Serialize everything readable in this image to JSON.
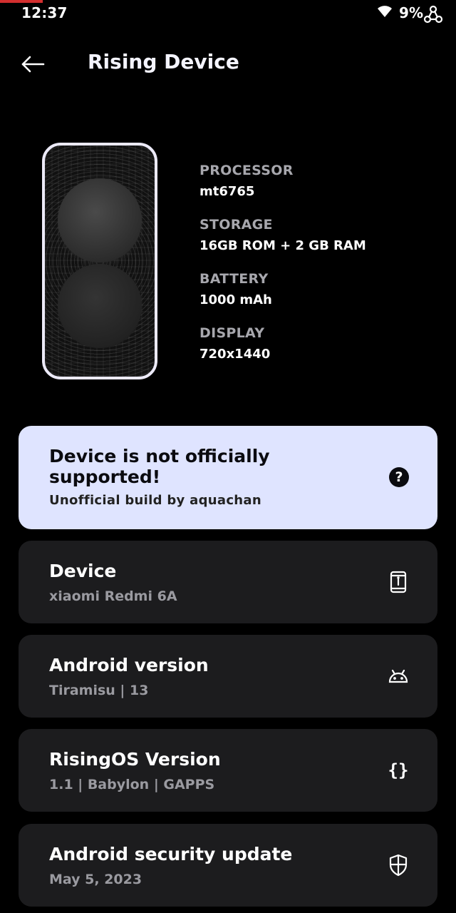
{
  "status_bar": {
    "time": "12:37",
    "battery": "9%"
  },
  "header": {
    "title": "Rising Device"
  },
  "specs": [
    {
      "label": "PROCESSOR",
      "value": "mt6765"
    },
    {
      "label": "STORAGE",
      "value": "16GB ROM + 2 GB RAM"
    },
    {
      "label": "BATTERY",
      "value": "1000 mAh"
    },
    {
      "label": "DISPLAY",
      "value": "720x1440"
    }
  ],
  "support_card": {
    "title": "Device is not officially supported!",
    "subtitle": "Unofficial build by aquachan",
    "help_glyph": "?",
    "bg_color": "#dfe4ff"
  },
  "info_cards": [
    {
      "title": "Device",
      "subtitle": "xiaomi Redmi 6A",
      "icon": "phone-info-icon"
    },
    {
      "title": "Android version",
      "subtitle": "Tiramisu | 13",
      "icon": "android-icon"
    },
    {
      "title": "RisingOS Version",
      "subtitle": "1.1 | Babylon | GAPPS",
      "icon": "braces-icon",
      "glyph": "{}"
    },
    {
      "title": "Android security update",
      "subtitle": "May 5, 2023",
      "icon": "shield-icon"
    }
  ]
}
